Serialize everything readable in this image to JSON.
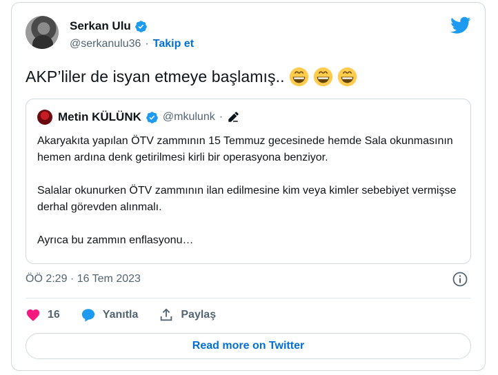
{
  "author": {
    "name": "Serkan Ulu",
    "handle": "@serkanulu36",
    "separator": "·",
    "follow_label": "Takip et"
  },
  "tweet": {
    "text": "AKP’liler de isyan etmeye başlamış..",
    "emoji": [
      "grinning-face-icon",
      "grinning-face-icon",
      "grinning-face-icon"
    ]
  },
  "quoted": {
    "name": "Metin KÜLÜNK",
    "handle": "@mkulunk",
    "separator": "·",
    "paragraphs": [
      "Akaryakıta yapılan ÖTV zammının 15 Temmuz gecesinede hemde Sala okunmasının hemen ardına denk getirilmesi kirli bir operasyona benziyor.",
      "Salalar okunurken ÖTV zammının ilan edilmesine kim veya kimler sebebiyet vermişse derhal görevden alınmalı.",
      "Ayrıca bu zammın enflasyonu…"
    ]
  },
  "timestamp": "ÖÖ 2:29 · 16 Tem 2023",
  "actions": {
    "like_count": "16",
    "reply_label": "Yanıtla",
    "share_label": "Paylaş"
  },
  "read_more_label": "Read more on Twitter",
  "colors": {
    "accent": "#1d9bf0",
    "link": "#006fd6",
    "like": "#f91880",
    "muted": "#536471",
    "border": "#cfd9de"
  }
}
